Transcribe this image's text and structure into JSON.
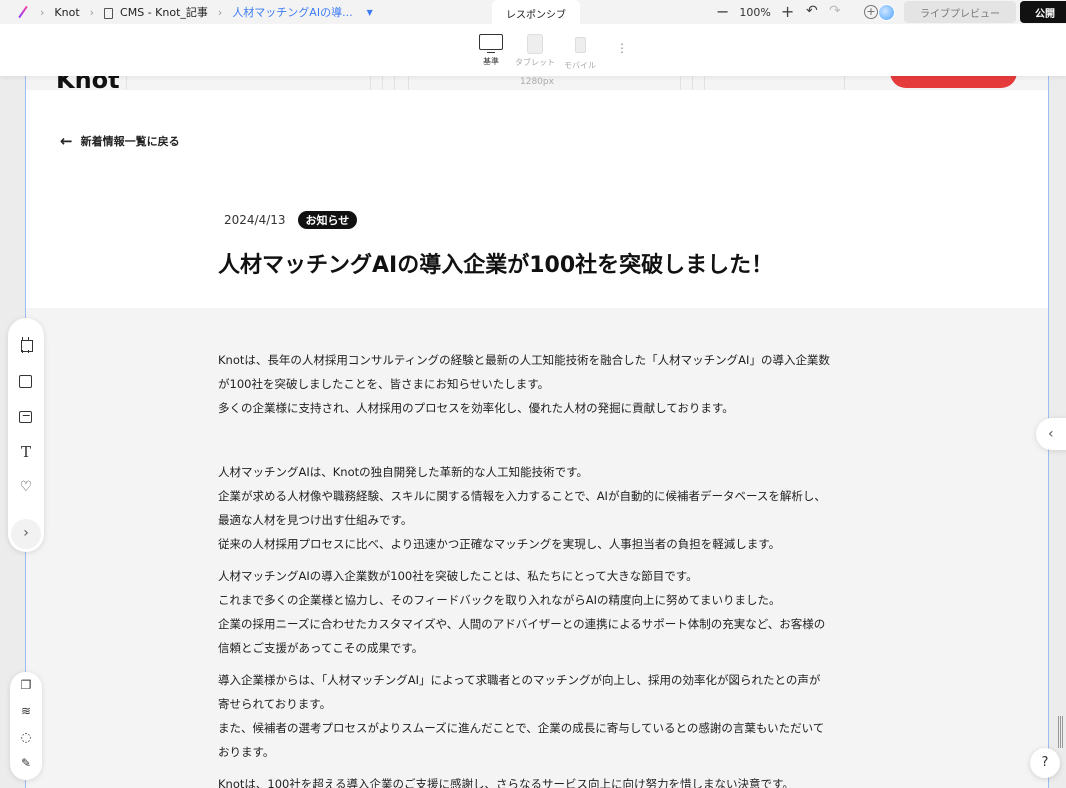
{
  "topbar": {
    "breadcrumbs": [
      "Knot",
      "CMS - Knot_記事",
      "人材マッチングAIの導..."
    ],
    "mode_tab": "レスポンシブ",
    "zoom": "100%",
    "preview_label": "ライブプレビュー",
    "publish_label": "公開"
  },
  "breakpoints": {
    "base": "基準",
    "tablet": "タブレット",
    "mobile": "モバイル",
    "width_label": "1280px"
  },
  "site": {
    "logo_text": "Knot"
  },
  "article": {
    "back_label": "新着情報一覧に戻る",
    "date": "2024/4/13",
    "tag": "お知らせ",
    "title": "人材マッチングAIの導入企業が100社を突破しました！",
    "paragraphs": [
      {
        "lines": [
          "Knotは、長年の人材採用コンサルティングの経験と最新の人工知能技術を融合した「人材マッチングAI」の導入企業数",
          "が100社を突破しましたことを、皆さまにお知らせいたします。",
          "多くの企業様に支持され、人材採用のプロセスを効率化し、優れた人材の発掘に貢献しております。"
        ]
      },
      {
        "lines": [
          "人材マッチングAIは、Knotの独自開発した革新的な人工知能技術です。",
          "企業が求める人材像や職務経験、スキルに関する情報を入力することで、AIが自動的に候補者データベースを解析し、",
          "最適な人材を見つけ出す仕組みです。",
          "従来の人材採用プロセスに比べ、より迅速かつ正確なマッチングを実現し、人事担当者の負担を軽減します。"
        ]
      },
      {
        "lines": [
          "人材マッチングAIの導入企業数が100社を突破したことは、私たちにとって大きな節目です。",
          "これまで多くの企業様と協力し、そのフィードバックを取り入れながらAIの精度向上に努めてまいりました。",
          "企業の採用ニーズに合わせたカスタマイズや、人間のアドバイザーとの連携によるサポート体制の充実など、お客様の",
          "信頼とご支援があってこその成果です。"
        ]
      },
      {
        "lines": [
          "導入企業様からは、「人材マッチングAI」によって求職者とのマッチングが向上し、採用の効率化が図られたとの声が",
          "寄せられております。",
          "また、候補者の選考プロセスがよりスムーズに進んだことで、企業の成長に寄与しているとの感謝の言葉もいただいて",
          "おります。"
        ]
      },
      {
        "lines": [
          "Knotは、100社を超える導入企業のご支援に感謝し、さらなるサービス向上に向け努力を惜しまない決意です。"
        ]
      }
    ]
  },
  "colors": {
    "accent": "#3e7cf6",
    "tag_bg": "#111111",
    "cta_red": "#e63b3b"
  },
  "icons": {
    "left_tools": [
      "frame-icon",
      "rectangle-icon",
      "image-icon",
      "text-icon",
      "heart-icon",
      "chevron-right-icon"
    ],
    "bottom_tools": [
      "pages-icon",
      "layers-icon",
      "comment-icon",
      "pen-icon"
    ]
  }
}
